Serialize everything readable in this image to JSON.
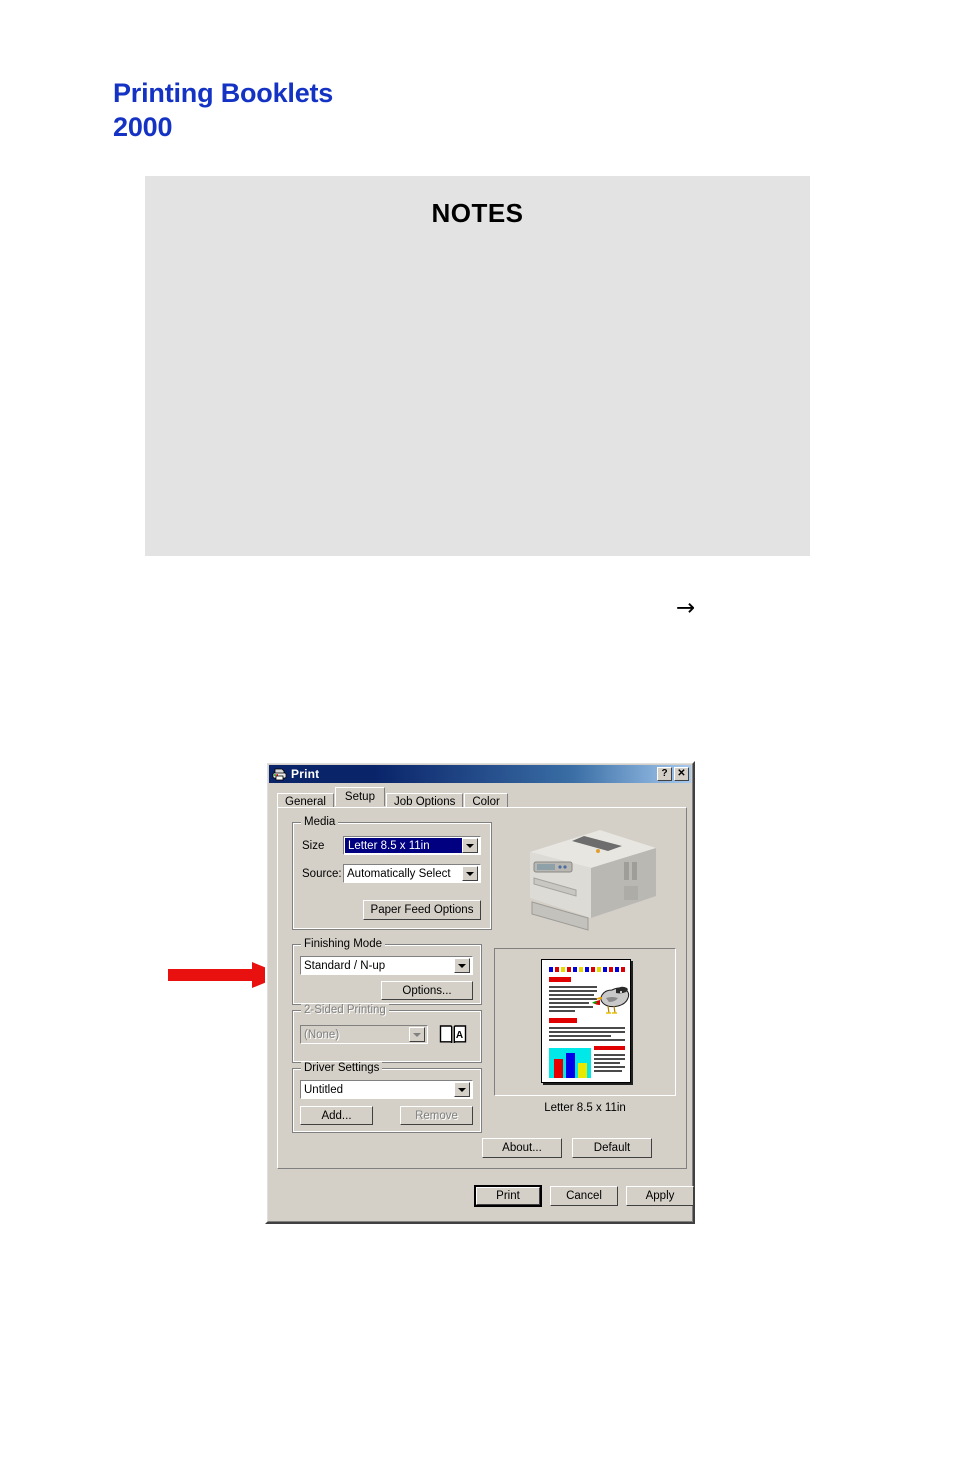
{
  "document": {
    "title_line1": "Printing Booklets",
    "title_line2": "2000",
    "title_color": "#1433c4",
    "notes_heading": "NOTES",
    "inline_arrow_glyph": "→"
  },
  "dialog": {
    "title": "Print",
    "titlebar_icon": "printer-icon",
    "help_button": "?",
    "close_button": "✕",
    "tabs": [
      {
        "label": "General",
        "active": false
      },
      {
        "label": "Setup",
        "active": true
      },
      {
        "label": "Job Options",
        "active": false
      },
      {
        "label": "Color",
        "active": false
      }
    ],
    "media": {
      "group_label": "Media",
      "size_label": "Size",
      "size_value": "Letter 8.5 x 11in",
      "size_selected": true,
      "source_label": "Source:",
      "source_value": "Automatically Select",
      "paper_feed_button": "Paper Feed Options"
    },
    "finishing": {
      "group_label": "Finishing Mode",
      "value": "Standard / N-up",
      "options_button": "Options..."
    },
    "two_sided": {
      "group_label": "2-Sided Printing",
      "value": "(None)",
      "disabled": true,
      "icon": "open-book-icon",
      "icon_letter": "A"
    },
    "driver_settings": {
      "group_label": "Driver Settings",
      "value": "Untitled",
      "add_button": "Add...",
      "remove_button": "Remove",
      "remove_disabled": true
    },
    "preview": {
      "caption": "Letter 8.5 x 11in",
      "printer_image": "printer-illustration",
      "page_image": "document-preview-thumbnail"
    },
    "secondary_buttons": [
      {
        "label": "About..."
      },
      {
        "label": "Default"
      }
    ],
    "action_buttons": [
      {
        "label": "Print",
        "default": true
      },
      {
        "label": "Cancel",
        "default": false
      },
      {
        "label": "Apply",
        "default": false
      }
    ]
  },
  "annotations": {
    "callout_arrow": "red-arrow-pointing-to-finishing-mode",
    "callout_color": "#e8110f"
  }
}
